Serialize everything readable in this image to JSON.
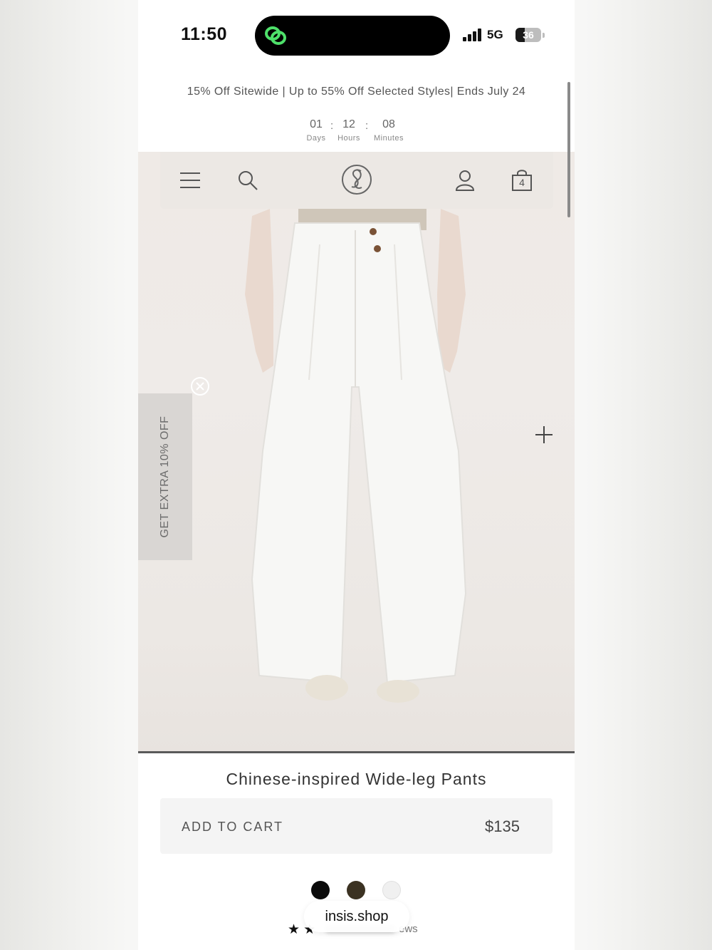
{
  "status_bar": {
    "time": "11:50",
    "network": "5G",
    "battery": "36",
    "battery_level": 0.36
  },
  "promo": {
    "banner": "15% Off Sitewide | Up to 55% Off Selected Styles| Ends July 24",
    "countdown": [
      {
        "value": "01",
        "label": "Days"
      },
      {
        "value": "12",
        "label": "Hours"
      },
      {
        "value": "08",
        "label": "Minutes"
      }
    ],
    "separator": ":"
  },
  "nav": {
    "icons": [
      "menu-icon",
      "search-icon",
      "brand-logo",
      "account-icon",
      "cart-icon"
    ],
    "cart_count": "4"
  },
  "side_promo": {
    "text": "GET EXTRA 10% OFF"
  },
  "product": {
    "title": "Chinese-inspired Wide-leg Pants",
    "add_to_cart": "ADD TO CART",
    "price": "$135",
    "swatches": [
      "#0b0b0b",
      "#3b3222",
      "#f0f0f0"
    ],
    "reviews_suffix": "ews"
  },
  "browser": {
    "domain": "insis.shop"
  },
  "colors": {
    "accent_green": "#4ee06a",
    "text_dark": "#111111"
  }
}
